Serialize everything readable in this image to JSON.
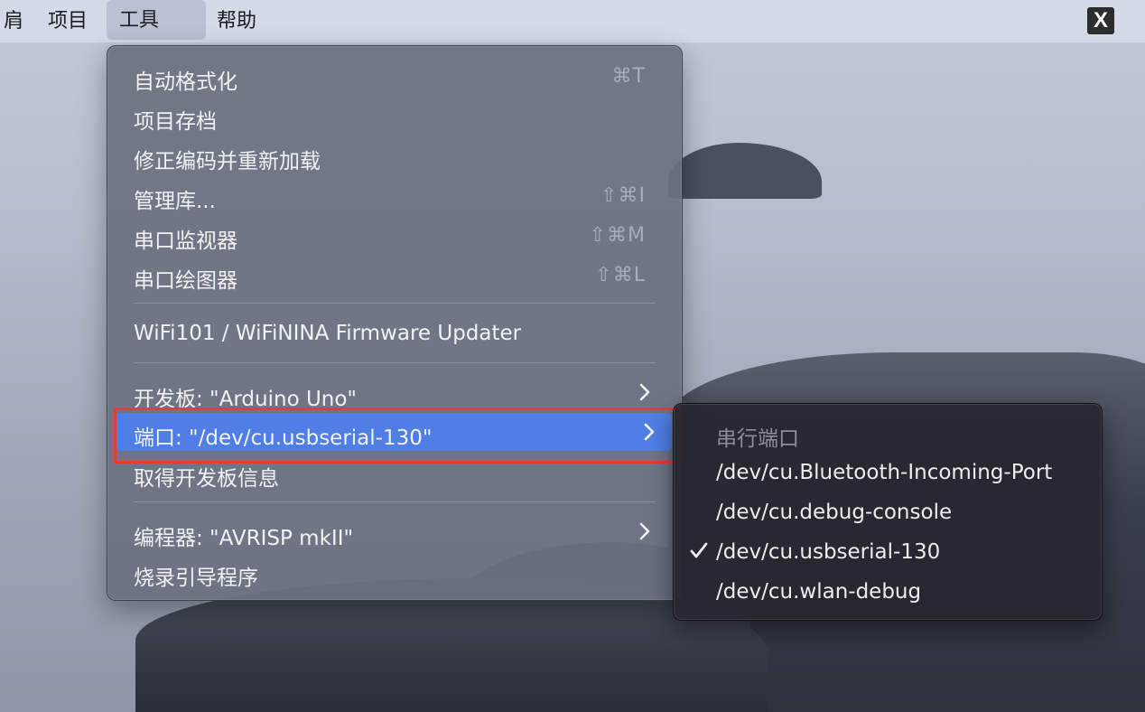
{
  "menubar": {
    "partial": "肩",
    "items": [
      "项目",
      "工具",
      "帮助"
    ],
    "active_index": 1,
    "app_icon_glyph": "X"
  },
  "tools_menu": {
    "items": [
      {
        "label": "自动格式化",
        "shortcut": "⌘T"
      },
      {
        "label": "项目存档",
        "shortcut": ""
      },
      {
        "label": "修正编码并重新加载",
        "shortcut": ""
      },
      {
        "label": "管理库...",
        "shortcut": "⇧⌘I"
      },
      {
        "label": "串口监视器",
        "shortcut": "⇧⌘M"
      },
      {
        "label": "串口绘图器",
        "shortcut": "⇧⌘L"
      },
      {
        "label": "WiFi101 / WiFiNINA Firmware Updater",
        "shortcut": ""
      },
      {
        "label": "开发板: \"Arduino Uno\"",
        "submenu": true
      },
      {
        "label": "端口: \"/dev/cu.usbserial-130\"",
        "submenu": true,
        "highlighted": true
      },
      {
        "label": "取得开发板信息",
        "shortcut": ""
      },
      {
        "label": "编程器: \"AVRISP mkII\"",
        "submenu": true
      },
      {
        "label": "烧录引导程序",
        "shortcut": ""
      }
    ]
  },
  "port_submenu": {
    "header": "串行端口",
    "items": [
      {
        "label": "/dev/cu.Bluetooth-Incoming-Port",
        "checked": false
      },
      {
        "label": "/dev/cu.debug-console",
        "checked": false
      },
      {
        "label": "/dev/cu.usbserial-130",
        "checked": true
      },
      {
        "label": "/dev/cu.wlan-debug",
        "checked": false
      }
    ]
  },
  "colors": {
    "highlight": "#4f7fe6",
    "annotation_box": "#e1412c"
  }
}
